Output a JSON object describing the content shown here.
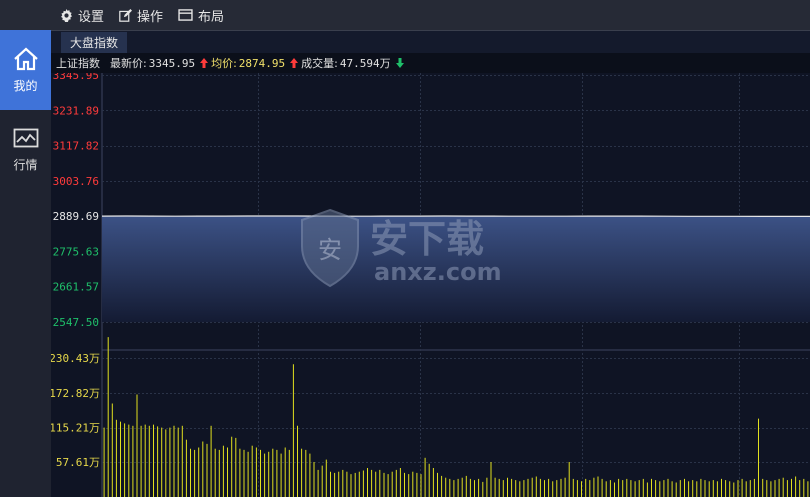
{
  "toolbar": {
    "settings_label": "设置",
    "operate_label": "操作",
    "layout_label": "布局"
  },
  "sidebar": {
    "mine_label": "我的",
    "market_label": "行情"
  },
  "tab": {
    "label": "大盘指数"
  },
  "infobar": {
    "index_name": "上证指数",
    "latest_label": "最新价:",
    "latest_value": "3345.95",
    "avg_label": "均价:",
    "avg_value": "2874.95",
    "volume_label": "成交量:",
    "volume_value": "47.594万"
  },
  "colors": {
    "up": "#ff3b3b",
    "down": "#1fbf6a",
    "avg_line": "#f1e06a",
    "volume_bar": "#e1e01e",
    "background": "#0f1424"
  },
  "watermark": {
    "cn_text": "安下载",
    "en_text": "anxz.com",
    "badge_char": "安"
  },
  "chart_data": {
    "type": "line",
    "price_axis": {
      "ticks": [
        {
          "value": 3345.95,
          "label": "3345.95",
          "kind": "up"
        },
        {
          "value": 3231.89,
          "label": "3231.89",
          "kind": "up"
        },
        {
          "value": 3117.82,
          "label": "3117.82",
          "kind": "up"
        },
        {
          "value": 3003.76,
          "label": "3003.76",
          "kind": "up"
        },
        {
          "value": 2889.69,
          "label": "2889.69",
          "kind": "base"
        },
        {
          "value": 2775.63,
          "label": "2775.63",
          "kind": "down"
        },
        {
          "value": 2661.57,
          "label": "2661.57",
          "kind": "down"
        },
        {
          "value": 2547.5,
          "label": "2547.50",
          "kind": "down"
        }
      ],
      "ylim": [
        2547.5,
        3345.95
      ]
    },
    "price_series": [
      2889.9,
      2890.0,
      2889.8,
      2889.6,
      2889.7,
      2889.9,
      2890.1,
      2890.2,
      2890.0,
      2889.8,
      2889.6,
      2889.5,
      2889.7,
      2889.9,
      2890.0,
      2889.9,
      2889.7,
      2889.6,
      2889.5,
      2889.6,
      2889.8,
      2889.9,
      2889.7,
      2889.5,
      2889.3,
      2889.2,
      2889.1,
      2889.0,
      2888.9,
      2888.8
    ],
    "volume_axis": {
      "ticks": [
        {
          "value": 230.43,
          "label": "230.43万"
        },
        {
          "value": 172.82,
          "label": "172.82万"
        },
        {
          "value": 115.21,
          "label": "115.21万"
        },
        {
          "value": 57.61,
          "label": "57.61万"
        }
      ],
      "ylim": [
        0,
        230.43
      ]
    },
    "volume_unit": "万",
    "volume_series": [
      115,
      265,
      155,
      128,
      125,
      122,
      120,
      118,
      170,
      118,
      120,
      118,
      120,
      117,
      115,
      112,
      115,
      118,
      115,
      118,
      95,
      80,
      78,
      82,
      92,
      88,
      118,
      80,
      78,
      85,
      82,
      100,
      98,
      80,
      78,
      75,
      85,
      82,
      78,
      72,
      75,
      80,
      78,
      72,
      82,
      78,
      220,
      118,
      80,
      78,
      72,
      58,
      45,
      52,
      62,
      42,
      40,
      42,
      45,
      42,
      38,
      40,
      42,
      44,
      48,
      45,
      42,
      45,
      40,
      38,
      42,
      45,
      48,
      40,
      38,
      42,
      40,
      38,
      65,
      55,
      48,
      40,
      35,
      32,
      30,
      28,
      30,
      32,
      35,
      30,
      28,
      30,
      25,
      32,
      58,
      32,
      30,
      28,
      32,
      30,
      28,
      26,
      28,
      30,
      32,
      34,
      30,
      28,
      30,
      26,
      28,
      30,
      32,
      58,
      30,
      28,
      26,
      30,
      28,
      32,
      34,
      30,
      26,
      28,
      24,
      30,
      28,
      30,
      28,
      26,
      28,
      30,
      24,
      30,
      28,
      26,
      28,
      30,
      26,
      24,
      28,
      30,
      26,
      28,
      26,
      30,
      28,
      26,
      28,
      26,
      30,
      28,
      26,
      24,
      28,
      30,
      26,
      28,
      30,
      130,
      30,
      28,
      26,
      28,
      30,
      32,
      28,
      30,
      34,
      28,
      30,
      26
    ]
  }
}
